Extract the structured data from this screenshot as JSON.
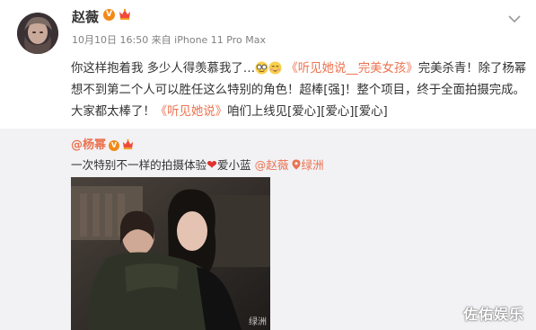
{
  "post": {
    "username": "赵薇",
    "verified_badge": "V",
    "vip_icon": "vip-crown-icon",
    "meta": "10月10日 16:50 来自 iPhone 11 Pro Max",
    "content": {
      "part1": "你这样抱着我 多少人得羡慕我了…",
      "emoji1": "glasses-emoji-icon",
      "emoji2": "shy-emoji-icon",
      "link1": "《听见她说__完美女孩》",
      "part2": "完美杀青！除了杨幂想不到第二个人可以胜任这么特别的角色！超棒[强]！整个项目，终于全面拍摄完成。大家都太棒了！",
      "link2": "《听见她说》",
      "part3": "咱们上线见[爱心][爱心][爱心]"
    }
  },
  "repost": {
    "author": "@杨幂",
    "verified_badge": "V",
    "text_before": "一次特别不一样的拍摄体验",
    "heart": "❤",
    "text_after": "爱小蓝",
    "mention": "@赵薇",
    "location": "绿洲",
    "photo_watermark": "绿洲"
  },
  "watermark": "佐佑娱乐",
  "colors": {
    "link": "#eb7350",
    "badge": "#f28a18",
    "repost_bg": "#f2f2f5",
    "heart": "#e0322f"
  }
}
